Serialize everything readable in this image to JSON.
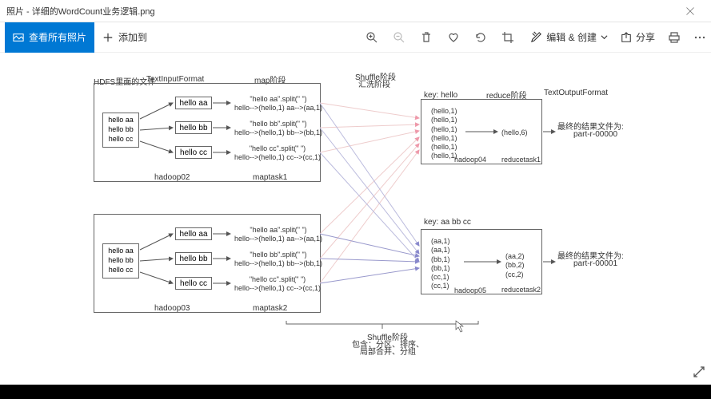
{
  "window": {
    "title": "照片 - 详细的WordCount业务逻辑.png"
  },
  "toolbar": {
    "viewAll": "查看所有照片",
    "addTo": "添加到",
    "editCreate": "编辑 & 创建",
    "share": "分享"
  },
  "labels": {
    "hdfs": "HDFS里面的文件",
    "textInput": "TextInputFormat",
    "mapStage": "map阶段",
    "shuffleStage": "Shuffle阶段",
    "shuffleSub": "汇洗阶段",
    "reduceStage": "reduce阶段",
    "textOutput": "TextOutputFormat",
    "key1": "key:   hello",
    "key2": "key:   aa bb cc",
    "finalResult1": "最终的结果文件为:",
    "part0": "part-r-00000",
    "finalResult2": "最终的结果文件为:",
    "part1": "part-r-00001",
    "hadoop02": "hadoop02",
    "hadoop03": "hadoop03",
    "hadoop04": "hadoop04",
    "hadoop05": "hadoop05",
    "maptask1": "maptask1",
    "maptask2": "maptask2",
    "reducetask1": "reducetask1",
    "reducetask2": "reducetask2",
    "shuffleNote1": "Shuffle阶段",
    "shuffleNote2": "包含：分区、排序、",
    "shuffleNote3": "局部合并、分组"
  },
  "inputLines": "hello aa\nhello bb\nhello cc",
  "map": {
    "aa": "hello aa",
    "bb": "hello bb",
    "cc": "hello cc",
    "splitAA": "\"hello aa\".split(\" \")\nhello-->(hello,1)  aa-->(aa,1)",
    "splitBB": "\"hello bb\".split(\" \")\nhello-->(hello,1)  bb-->(bb,1)",
    "splitCC": "\"hello cc\".split(\" \")\nhello-->(hello,1)  cc-->(cc,1)"
  },
  "reduce1": {
    "pairs": "(hello,1)\n(hello,1)\n(hello,1)\n(hello,1)\n(hello,1)\n(hello,1)",
    "out": "(hello,6)"
  },
  "reduce2": {
    "pairs": "(aa,1)\n(aa,1)\n(bb,1)\n(bb,1)\n(cc,1)\n(cc,1)",
    "out": "(aa,2)\n(bb,2)\n(cc,2)"
  }
}
